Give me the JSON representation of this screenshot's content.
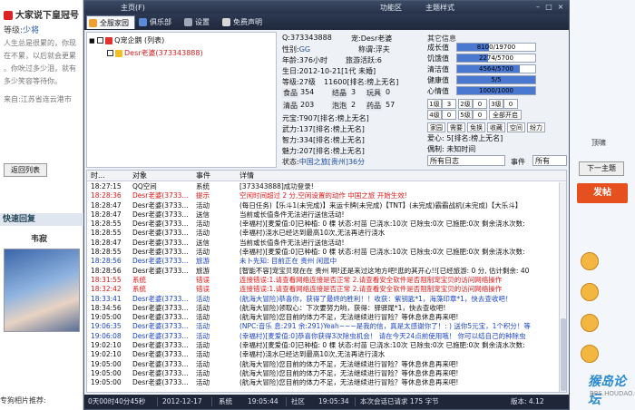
{
  "left_panel": {
    "title": "大家说下皇冠号",
    "level_label": "等级:",
    "level_value": "少将",
    "paragraph": [
      "人生总是很累的，你现",
      "在不累，以后就会更累",
      "。你吮过多少泪，就有",
      "多少笑容等待你。",
      "",
      "来自:江苏省连云港市"
    ],
    "return_button": "返回列表",
    "quick_reply": "快速回复",
    "user_name": "韦寂",
    "recommend": "专狗相片推荐:"
  },
  "right_panel": {
    "line_text": "顶啸",
    "next_button": "下一主题",
    "send_button": "发帖",
    "logo": "猴岛论坛",
    "logo_url": "BBS.HOUDAO.COM"
  },
  "window": {
    "title": "主页(F)",
    "menu_function": "功能区",
    "menu_theme": "主题样式",
    "tabs": [
      {
        "label": "全服家园",
        "icon_color": "#f0a030"
      },
      {
        "label": "俱乐部",
        "icon_color": "#5a8ad8"
      },
      {
        "label": "设置",
        "icon_color": "#a0a8b8"
      },
      {
        "label": "免费声明",
        "icon_color": "#d8d8d8"
      }
    ]
  },
  "tree": {
    "root": "Q宠企鹅 (列表)",
    "child": "Desr老婆(373343888)"
  },
  "pet_info": {
    "qq": "Q:373343888",
    "pet": "宠:Desr老婆",
    "gender_label": "性别:",
    "gender": "GG",
    "title_label": "称谓:",
    "title": "浮夫",
    "age": "年龄:376小时",
    "travel": "旅游活跃:6",
    "birthday": "生日:2012-10-21[1代 未婚]",
    "level": "等级:27级",
    "exp": "11600[排名:榜上无名]",
    "stats": [
      {
        "label": "食品",
        "value": "354"
      },
      {
        "label": "结晶",
        "value": "3"
      },
      {
        "label": "玩具",
        "value": "0"
      },
      {
        "label": "清品",
        "value": "203"
      },
      {
        "label": "泡泡",
        "value": "2"
      },
      {
        "label": "药品",
        "value": "57"
      }
    ],
    "yuanbao": "元宝:T907[排名:榜上无名]",
    "wuli": "武力:137[排名:榜上无名]",
    "zhili": "智力:334[排名:榜上无名]",
    "meili": "魅力:207[排名:榜上无名]",
    "status_label": "状态:",
    "status": "中国之旅[贵州]36分"
  },
  "other_info": {
    "header": "其它信息",
    "bars": [
      {
        "label": "成长值",
        "text": "8100/19700",
        "fraction": 0.41,
        "color": "#4a78d0"
      },
      {
        "label": "饥饿值",
        "text": "2274/5700",
        "fraction": 0.4,
        "color": "#4a78d0"
      },
      {
        "label": "清洁值",
        "text": "4564/5700",
        "fraction": 0.8,
        "color": "#4a78d0"
      },
      {
        "label": "健康值",
        "text": "5/5",
        "fraction": 1.0,
        "color": "#4a78d0"
      },
      {
        "label": "心情值",
        "text": "1000/1000",
        "fraction": 1.0,
        "color": "#4a78d0"
      }
    ],
    "cells_row1": [
      "1级",
      "3",
      "2级",
      "0",
      "3级",
      "0"
    ],
    "cells_row2": [
      "4级",
      "0",
      "5级",
      "0",
      "全部开启"
    ],
    "action_buttons": [
      "家园",
      "需要",
      "免换",
      "收藏",
      "空间",
      "纷力"
    ],
    "aixin": "爱心: 5[排名:榜上无名]",
    "weixie": "偶制: 未知时间"
  },
  "filters": {
    "all_logs": "所有日志",
    "event_label": "事件",
    "all": "所有"
  },
  "log": {
    "headers": [
      "时...",
      "对象",
      "事件",
      "详情"
    ],
    "rows": [
      {
        "time": "18:27:15",
        "obj": "QQ空间",
        "event": "系统",
        "detail": "[373343888]成功登录!",
        "color": "normal"
      },
      {
        "time": "18:28:36",
        "obj": "Desr老婆(3733...",
        "event": "提示",
        "detail": "空闲时间超过 2 分,空闲设置的动作 中国之旅 开始生效!",
        "color": "red"
      },
      {
        "time": "18:28:47",
        "obj": "Desr老婆(3733...",
        "event": "活动",
        "detail": "(每日任务)【乐斗1(未完成)】来运卡牌(未完成)【TNT】(未完成)霸霸战机(未完成)【大乐斗】",
        "color": "normal"
      },
      {
        "time": "18:28:47",
        "obj": "Desr老婆(3733...",
        "event": "送信",
        "detail": "当前或长值条件无法进行送信活动!",
        "color": "normal"
      },
      {
        "time": "18:28:55",
        "obj": "Desr老婆(3733...",
        "event": "活动",
        "detail": "(幸福村)[麦爱值:0]已种植: 0 棵 状态:村苗 已浇水:10次 已除虫:0次 已施肥:0次 剩余浇水次数:",
        "color": "normal"
      },
      {
        "time": "18:28:55",
        "obj": "Desr老婆(3733...",
        "event": "活动",
        "detail": "(幸福村)浇水已经达到最高10次,无法再进行浇水",
        "color": "normal"
      },
      {
        "time": "18:28:47",
        "obj": "Desr老婆(3733...",
        "event": "送信",
        "detail": "当前或长值条件无法进行送信活动!",
        "color": "normal"
      },
      {
        "time": "18:28:55",
        "obj": "Desr老婆(3733...",
        "event": "活动",
        "detail": "(幸福村)[麦爱值:0]已种植: 0 棵 状态:村苗 已浇水:10次 已除虫:0次 已施肥:0次 剩余浇水次数:",
        "color": "normal"
      },
      {
        "time": "18:28:56",
        "obj": "Desr老婆(3733...",
        "event": "旅游",
        "detail": "未卜先知: 目前正在 贵州 闲逛中",
        "color": "blue"
      },
      {
        "time": "18:28:56",
        "obj": "Desr老婆(3733...",
        "event": "旅游",
        "detail": "[智能不容]宠宝贝现在在 贵州 啊!还是来过这地方吧!逛的其开心!![已经旅游: 0 分, 估计剩余: 40",
        "color": "normal"
      },
      {
        "time": "18:31:55",
        "obj": "系统",
        "event": "错误",
        "detail": "连接错误:1.请查看网络连接是否正常 2.请查看安全软件是否阻制宠宝贝的访问网络操作",
        "color": "red"
      },
      {
        "time": "18:32:42",
        "obj": "系统",
        "event": "错误",
        "detail": "连接错误:1.请查看网络连接是否正常 2.请查看安全软件是否阻制宠宝贝的访问网络操作",
        "color": "red"
      },
      {
        "time": "18:33:41",
        "obj": "Desr老婆(3733...",
        "event": "活动",
        "detail": "(航海大冒险)恭喜你，获得了最终的胜利！！收获：紫钥匙*1，海藻印章*1，快去查收吧！",
        "color": "blue"
      },
      {
        "time": "18:34:56",
        "obj": "Desr老婆(3733...",
        "event": "活动",
        "detail": "(航海大冒险)领取心：下次要努力哟，获得：驿驿尾*1，快去查收吧!",
        "color": "normal"
      },
      {
        "time": "19:05:00",
        "obj": "Desr老婆(3733...",
        "event": "活动",
        "detail": "(航海大冒险)您目前的体力不足，无法继续进行冒险？等休息休息再来吧!",
        "color": "normal"
      },
      {
        "time": "19:06:35",
        "obj": "Desr老婆(3733...",
        "event": "活动",
        "detail": "(NPC:音乐 息:291 余:291)Yeah~~~是我的信，真是太感谢你了！: ) 送你5元宝，1个积分！等",
        "color": "blue"
      },
      {
        "time": "19:06:08",
        "obj": "Desr老婆(3733...",
        "event": "活动",
        "detail": "(幸福村)[麦爱值:0]恭喜你获得3次除虫机会！ 请在今天24点前使用哦！ 你可以结自己的种除虫",
        "color": "blue"
      },
      {
        "time": "19:02:10",
        "obj": "Desr老婆(3733...",
        "event": "活动",
        "detail": "(幸福村)[麦爱值:0]已种植: 0 棵 状态:村苗 已浇水:10次 已除虫:0次 已施肥:0次 剩余浇水次数:",
        "color": "normal"
      },
      {
        "time": "19:02:10",
        "obj": "Desr老婆(3733...",
        "event": "活动",
        "detail": "(幸福村)浇水已经达到最高10次,无法再进行浇水",
        "color": "normal"
      },
      {
        "time": "19:05:00",
        "obj": "Desr老婆(3733...",
        "event": "活动",
        "detail": "(航海大冒险)您目前的体力不足，无法继续进行冒险？等休息休息再来吧!",
        "color": "normal"
      },
      {
        "time": "19:05:00",
        "obj": "Desr老婆(3733...",
        "event": "活动",
        "detail": "(航海大冒险)您目前的体力不足，无法继续进行冒险？等休息休息再来吧!",
        "color": "normal"
      },
      {
        "time": "19:05:00",
        "obj": "Desr老婆(3733...",
        "event": "活动",
        "detail": "(航海大冒险)您目前的体力不足，无法继续进行冒险？等休息休息再来吧!",
        "color": "normal"
      }
    ]
  },
  "statusbar": {
    "uptime": "0天00时40分45秒",
    "date": "2012-12-17",
    "sys_label": "系统",
    "sys_time": "19:05:44",
    "community_label": "社区",
    "community_time": "19:05:34",
    "session": "本次会话已请求 175 字节",
    "version": "版本: 4.12"
  }
}
